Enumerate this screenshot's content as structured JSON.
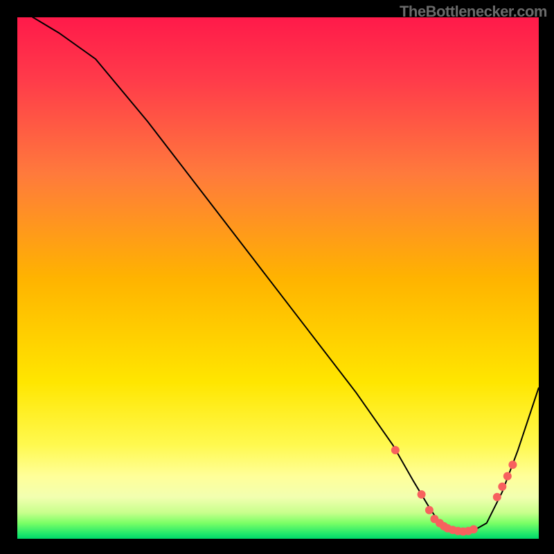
{
  "attribution": "TheBottlenecker.com",
  "chart_data": {
    "type": "line",
    "title": "",
    "xlabel": "",
    "ylabel": "",
    "xlim": [
      0,
      100
    ],
    "ylim": [
      0,
      100
    ],
    "x": [
      0,
      3,
      8,
      15,
      25,
      35,
      45,
      55,
      65,
      72,
      76,
      79,
      81,
      83,
      85,
      87,
      90,
      93,
      96,
      100
    ],
    "curve": [
      102,
      100,
      97,
      92,
      80,
      67,
      54,
      41,
      28,
      18,
      11,
      6,
      3,
      1.8,
      1.2,
      1.3,
      3,
      9,
      17,
      29
    ],
    "highlight_points": [
      {
        "x": 72.5,
        "y": 17.0
      },
      {
        "x": 77.5,
        "y": 8.5
      },
      {
        "x": 79.0,
        "y": 5.5
      },
      {
        "x": 80.0,
        "y": 3.8
      },
      {
        "x": 81.0,
        "y": 3.0
      },
      {
        "x": 81.8,
        "y": 2.4
      },
      {
        "x": 82.5,
        "y": 2.0
      },
      {
        "x": 83.5,
        "y": 1.7
      },
      {
        "x": 84.5,
        "y": 1.5
      },
      {
        "x": 85.5,
        "y": 1.4
      },
      {
        "x": 86.5,
        "y": 1.5
      },
      {
        "x": 87.5,
        "y": 1.8
      },
      {
        "x": 92.0,
        "y": 8.0
      },
      {
        "x": 93.0,
        "y": 10.0
      },
      {
        "x": 94.0,
        "y": 12.0
      },
      {
        "x": 95.0,
        "y": 14.2
      }
    ],
    "colors": {
      "curve": "#000000",
      "points": "#f7615e",
      "gradient_top": "#ff1a4a",
      "gradient_bottom": "#00d86a"
    }
  }
}
